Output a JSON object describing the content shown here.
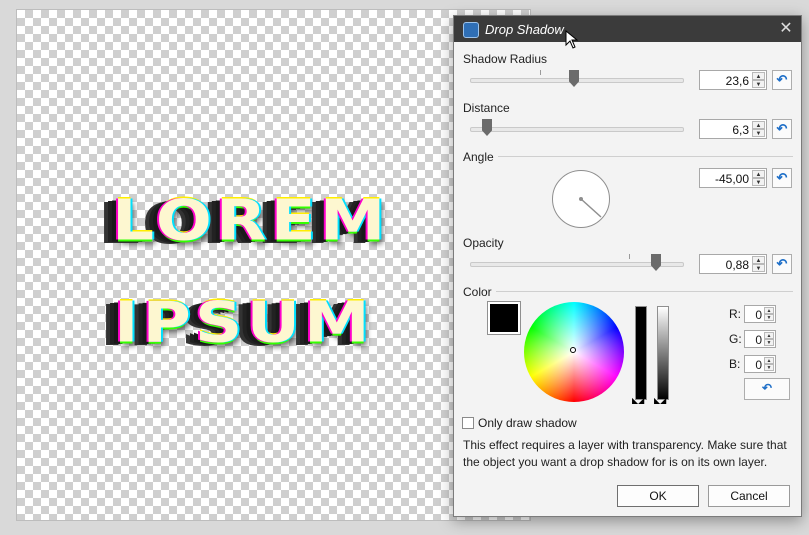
{
  "canvas": {
    "artwork_line1": "LOREM",
    "artwork_line2": "IPSUM"
  },
  "dialog": {
    "title": "Drop Shadow",
    "close_label": "✕",
    "shadow_radius": {
      "label": "Shadow Radius",
      "value": "23,6",
      "level": 0.24
    },
    "distance": {
      "label": "Distance",
      "value": "6,3",
      "level": 0.06
    },
    "angle": {
      "label": "Angle",
      "value": "-45,00"
    },
    "opacity": {
      "label": "Opacity",
      "value": "0,88",
      "level": 0.88
    },
    "color": {
      "label": "Color",
      "swatch": "#000000",
      "r_label": "R:",
      "r_value": "0",
      "g_label": "G:",
      "g_value": "0",
      "b_label": "B:",
      "b_value": "0"
    },
    "only_draw_shadow": {
      "label": "Only draw shadow",
      "checked": false
    },
    "info_text": "This effect requires a layer with transparency. Make sure that the object you want a drop shadow for is on its own layer.",
    "ok_label": "OK",
    "cancel_label": "Cancel",
    "reset_icon": "↶"
  },
  "colors": {
    "titlebar": "#3b3b3b",
    "accent": "#1e6fc8"
  }
}
